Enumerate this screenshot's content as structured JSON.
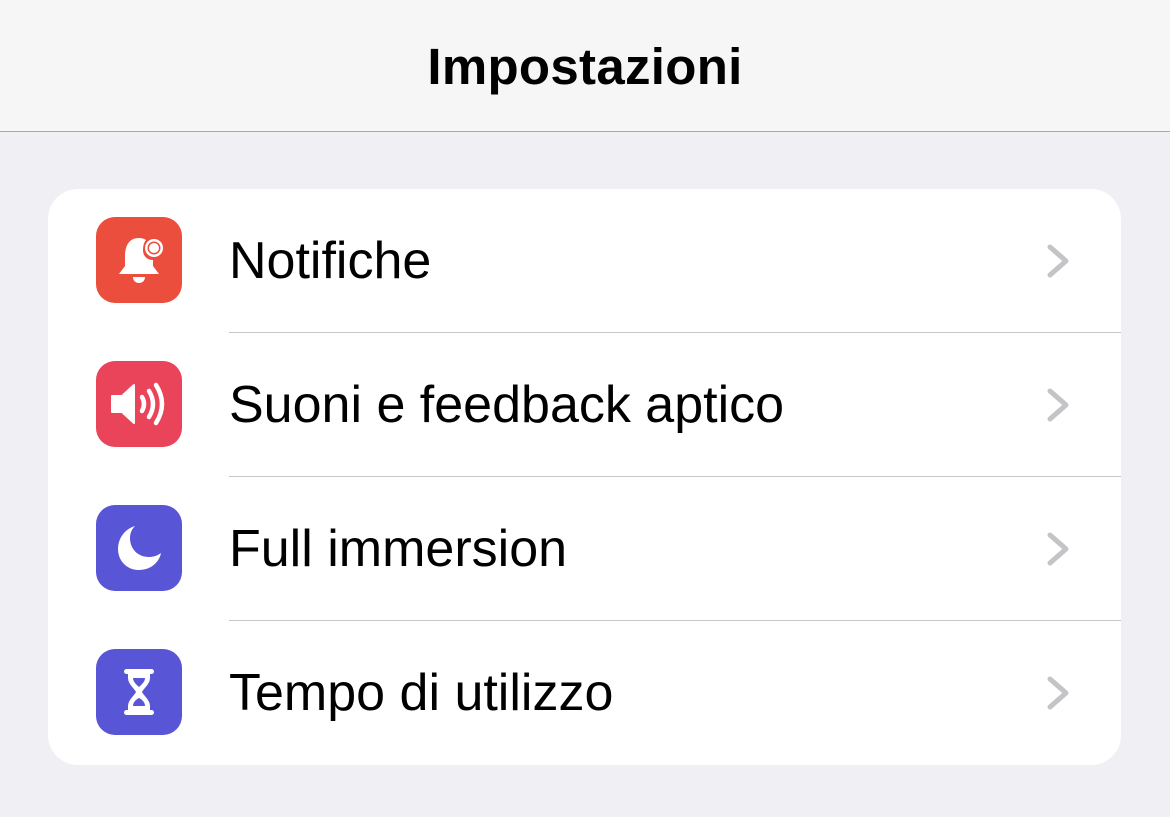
{
  "header": {
    "title": "Impostazioni"
  },
  "settings": {
    "items": [
      {
        "label": "Notifiche",
        "icon": "bell-badge-icon",
        "color": "#ec4e3d"
      },
      {
        "label": "Suoni e feedback aptico",
        "icon": "speaker-wave-icon",
        "color": "#ea445a"
      },
      {
        "label": "Full immersion",
        "icon": "moon-icon",
        "color": "#5856d6"
      },
      {
        "label": "Tempo di utilizzo",
        "icon": "hourglass-icon",
        "color": "#5856d6"
      }
    ]
  },
  "colors": {
    "background": "#f0eff4",
    "navbar": "#f6f6f6",
    "chevron": "#c4c4c7",
    "separator": "#c6c6c8"
  }
}
